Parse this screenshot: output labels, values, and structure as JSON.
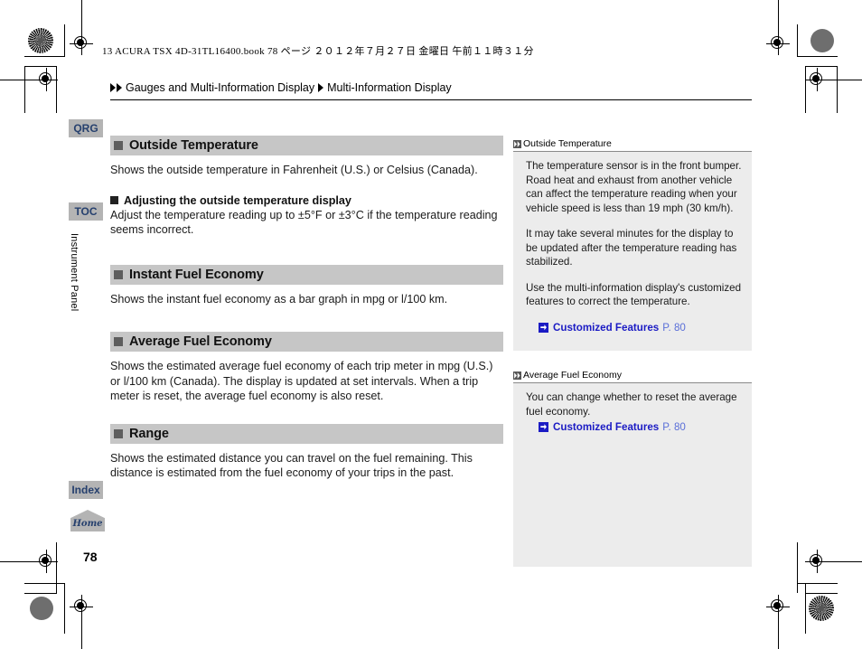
{
  "print": {
    "file_header": "13 ACURA TSX 4D-31TL16400.book   78 ページ   ２０１２年７月２７日   金曜日   午前１１時３１分",
    "page_number": "78"
  },
  "breadcrumb": {
    "level1": "Gauges and Multi-Information Display",
    "level2": "Multi-Information Display"
  },
  "side_tabs": {
    "qrg": "QRG",
    "toc": "TOC",
    "index": "Index",
    "home": "Home",
    "chapter": "Instrument Panel"
  },
  "sections": [
    {
      "title": "Outside Temperature",
      "body": "Shows the outside temperature in Fahrenheit (U.S.) or Celsius (Canada).",
      "sub_title": "Adjusting the outside temperature display",
      "sub_body": "Adjust the temperature reading up to ±5°F or ±3°C if the temperature reading seems incorrect."
    },
    {
      "title": "Instant Fuel Economy",
      "body": "Shows the instant fuel economy as a bar graph in mpg or l/100 km."
    },
    {
      "title": "Average Fuel Economy",
      "body": "Shows the estimated average fuel economy of each trip meter in mpg (U.S.) or l/100 km (Canada). The display is updated at set intervals. When a trip meter is reset, the average fuel economy is also reset."
    },
    {
      "title": "Range",
      "body": "Shows the estimated distance you can travel on the fuel remaining. This distance is estimated from the fuel economy of your trips in the past."
    }
  ],
  "notes": [
    {
      "heading": "Outside Temperature",
      "paragraphs": [
        "The temperature sensor is in the front bumper. Road heat and exhaust from another vehicle can affect the temperature reading when your vehicle speed is less than 19 mph (30 km/h).",
        "It may take several minutes for the display to be updated after the temperature reading has stabilized.",
        "Use the multi-information display's customized features to correct the temperature."
      ],
      "xref_label": "Customized Features",
      "xref_page": "P. 80"
    },
    {
      "heading": "Average Fuel Economy",
      "paragraphs": [
        "You can change whether to reset the average fuel economy."
      ],
      "xref_label": "Customized Features",
      "xref_page": "P. 80"
    }
  ],
  "colors": {
    "section_bar": "#c6c6c6",
    "tab_bg": "#b4b4b4",
    "tab_text": "#26406e",
    "note_bg": "#ececec",
    "link_blue": "#1b1bc4"
  }
}
